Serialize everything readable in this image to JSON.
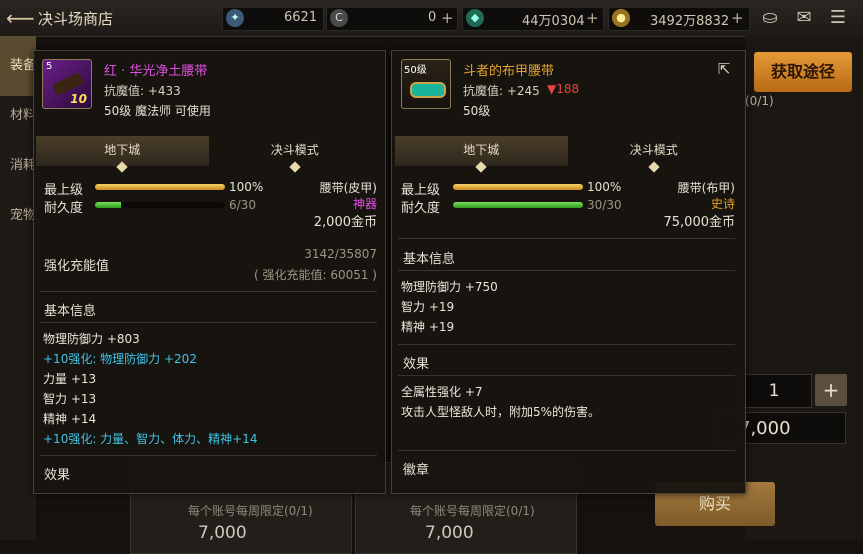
{
  "header": {
    "title": "决斗场商店",
    "currency1": "6621",
    "currency2": "0",
    "currency3": "44万0304",
    "currency4": "3492万8832"
  },
  "bg": {
    "tabs": [
      "装备",
      "材料",
      "消耗",
      "宠物"
    ],
    "price": "7,000",
    "limit": "每个账号每周限定(0/1)",
    "right_limit": "(0/1)",
    "desc_partial": "攻击人型怪敌人时，附加5%的伤害。",
    "desc_partial_prefix": "全属性强化 +7",
    "quantity": "1",
    "total": "7,000",
    "buy_label": "购买",
    "get_label": "获取途径"
  },
  "left_card": {
    "name": "红 · 华光净土腰带",
    "icon_level": "5",
    "icon_badge": "10",
    "anti_magic": "抗魔值: +433",
    "level_req": "50级 魔法师 可使用",
    "tab1": "地下城",
    "tab2": "决斗模式",
    "max_label": "最上级",
    "max_value": "100%",
    "max_fill": 1.0,
    "dur_label": "耐久度",
    "dur_value": "6/30",
    "dur_fill": 0.2,
    "type": "腰带(皮甲)",
    "rarity": "神器",
    "price": "2,000金币",
    "enhance_label": "强化充能值",
    "enhance_value": "3142/35807",
    "enhance_total": "( 强化充能值: 60051 )",
    "basic_label": "基本信息",
    "stats": [
      {
        "text": "物理防御力 +803",
        "cyan": false
      },
      {
        "text": "+10强化: 物理防御力 +202",
        "cyan": true
      },
      {
        "text": "力量 +13",
        "cyan": false
      },
      {
        "text": "智力 +13",
        "cyan": false
      },
      {
        "text": "精神 +14",
        "cyan": false
      },
      {
        "text": "+10强化: 力量、智力、体力、精神+14",
        "cyan": true
      }
    ],
    "effect_label": "效果"
  },
  "right_card": {
    "name": "斗者的布甲腰带",
    "icon_level": "50级",
    "anti_magic_prefix": "抗魔值: +245",
    "anti_magic_diff": "▼188",
    "level_req": "50级",
    "tab1": "地下城",
    "tab2": "决斗模式",
    "max_label": "最上级",
    "max_value": "100%",
    "max_fill": 1.0,
    "dur_label": "耐久度",
    "dur_value": "30/30",
    "dur_fill": 1.0,
    "type": "腰带(布甲)",
    "rarity": "史诗",
    "price": "75,000金币",
    "basic_label": "基本信息",
    "stats": [
      "物理防御力 +750",
      "智力 +19",
      "精神 +19"
    ],
    "effect_label": "效果",
    "effects": [
      "全属性强化 +7",
      "攻击人型怪敌人时，附加5%的伤害。"
    ],
    "emblem_label": "徽章"
  }
}
